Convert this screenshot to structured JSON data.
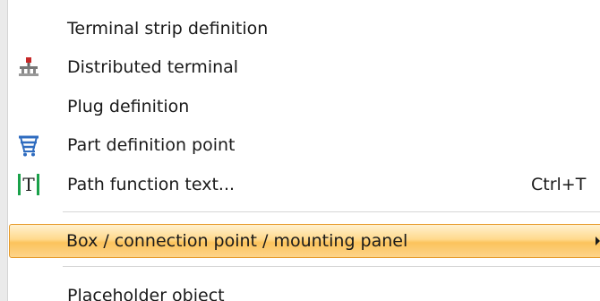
{
  "menu": {
    "items": [
      {
        "label": "Terminal strip definition"
      },
      {
        "label": "Distributed terminal",
        "icon": "distributed-terminal-icon"
      },
      {
        "label": "Plug definition"
      },
      {
        "label": "Part definition point",
        "icon": "cart-icon"
      },
      {
        "label": "Path function text...",
        "icon": "text-frame-icon",
        "icon_text": "T",
        "shortcut": "Ctrl+T"
      },
      {
        "label": "Box / connection point / mounting panel",
        "highlighted": true,
        "has_submenu": true
      },
      {
        "label": "Placeholder object"
      }
    ]
  },
  "colors": {
    "highlight_border": "#e69a2a",
    "highlight_fill": "#fcc35c",
    "icon_blue": "#2f6cc0",
    "icon_green": "#1aa14a",
    "icon_red": "#c62828"
  }
}
